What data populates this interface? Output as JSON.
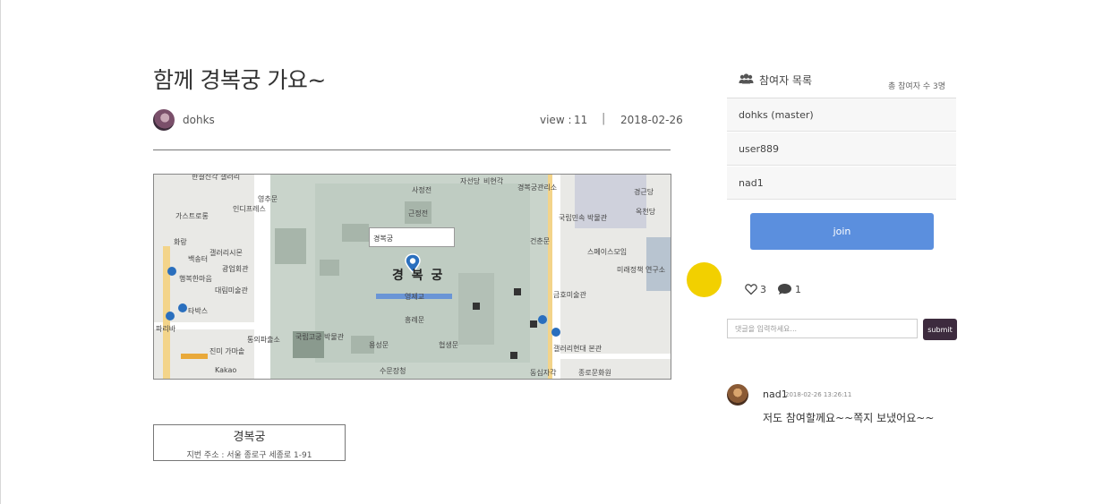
{
  "post": {
    "title": "함께 경복궁 가요~",
    "author": "dohks",
    "view_label": "view :",
    "view_count": "11",
    "separator": "|",
    "date": "2018-02-26"
  },
  "map": {
    "popup_label": "경복궁",
    "center_label": "경 복 궁",
    "labels": [
      "한결신각 갤러리",
      "인디프레스",
      "영추문",
      "사정전",
      "근정전",
      "흥례문",
      "영제교",
      "용성문",
      "협생문",
      "수문장청",
      "국립고궁 박물관",
      "통의파출소",
      "대림미술관",
      "백송터",
      "광업회관",
      "갤러리시몬",
      "국립민속 박물관",
      "건춘문",
      "스페이스모임",
      "금호미술관",
      "갤러리현대 본관",
      "동십자각",
      "종로문화원",
      "경근당",
      "옥천당",
      "미래정책 연구소",
      "자선당",
      "비현각",
      "경복궁관리소",
      "가스트로롱",
      "화랑",
      "행복한마음",
      "타박스",
      "파리바",
      "진미 가마솥",
      "Kakao"
    ]
  },
  "place": {
    "name": "경복궁",
    "address": "지번 주소 : 서울 종로구 세종로 1-91"
  },
  "participants": {
    "title": "참여자 목록",
    "count_label": "총 참여자 수 3명",
    "list": [
      "dohks (master)",
      "user889",
      "nad1"
    ],
    "join_label": "join"
  },
  "stats": {
    "likes": "3",
    "comments": "1"
  },
  "comment_form": {
    "placeholder": "댓글을 입력하세요...",
    "submit_label": "submit"
  },
  "comments": [
    {
      "author": "nad1",
      "time": "2018-02-26 13:26:11",
      "text": "저도 참여할께요~~쪽지 보냈어요~~"
    }
  ],
  "colors": {
    "join_button": "#5b8fde",
    "submit_button": "#3d2b3e",
    "cursor_highlight": "#f2d000"
  }
}
